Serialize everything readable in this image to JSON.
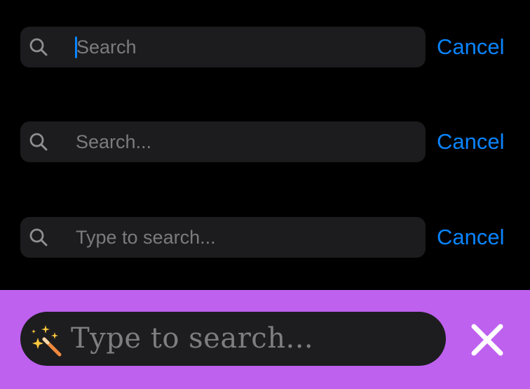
{
  "search_bars": [
    {
      "placeholder": "Search",
      "cancel_label": "Cancel",
      "focused": true
    },
    {
      "placeholder": "Search...",
      "cancel_label": "Cancel",
      "focused": false
    },
    {
      "placeholder": "Type to search...",
      "cancel_label": "Cancel",
      "focused": false
    }
  ],
  "custom_bar": {
    "placeholder": "Type to search...",
    "leading_icon": "magic-wand-icon",
    "trailing_icon": "close-icon",
    "background_color": "#be61ef"
  },
  "colors": {
    "accent": "#0a84ff",
    "field_background": "#1c1c1e",
    "placeholder": "#7b7b80",
    "page_background": "#000000"
  }
}
